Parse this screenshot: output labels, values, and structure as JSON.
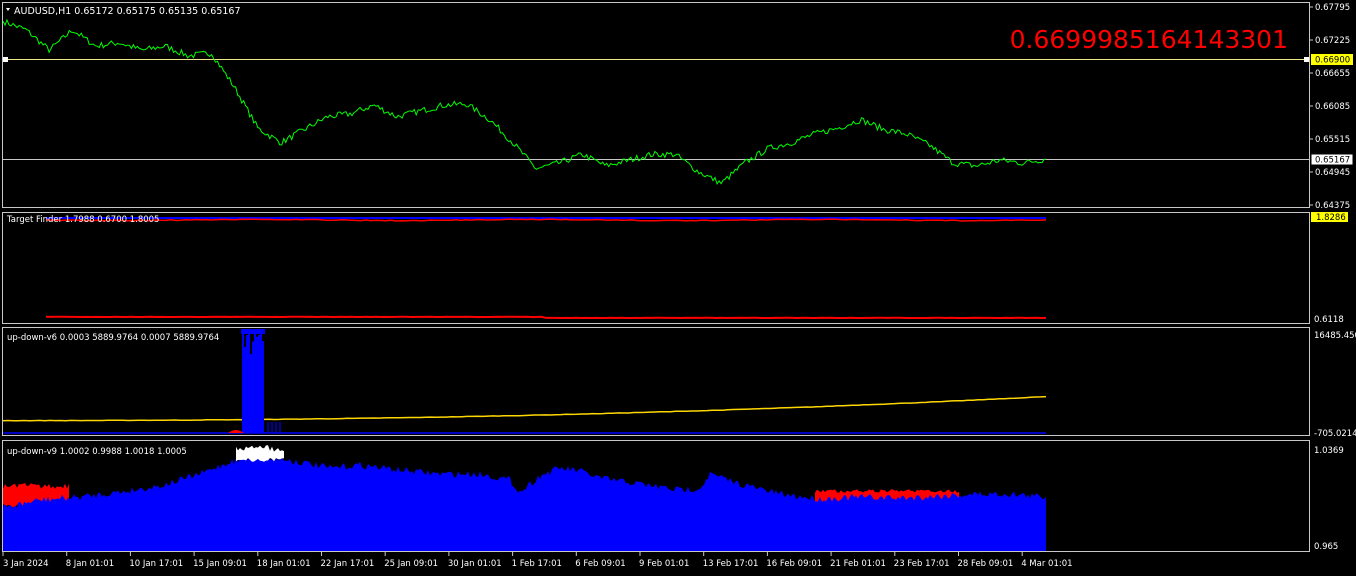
{
  "chart_data": [
    {
      "pane": "price",
      "type": "line",
      "header": "AUDUSD,H1  0.65172 0.65175 0.65135 0.65167",
      "symbol": "AUDUSD,H1",
      "ohlc": [
        0.65172,
        0.65175,
        0.65135,
        0.65167
      ],
      "big_label": "0.6699985164143301",
      "ylim": [
        0.64375,
        0.67795
      ],
      "y_ticks": [
        "0.67795",
        "0.67225",
        "0.66655",
        "0.66085",
        "0.65515",
        "0.64945",
        "0.64375"
      ],
      "horizontal_lines": [
        {
          "value": 0.669,
          "label": "0.66900",
          "color": "#f0e68c",
          "badge": "yellow"
        },
        {
          "value": 0.65167,
          "label": "0.65167",
          "color": "#c8c8c8",
          "badge": "white"
        }
      ],
      "series": [
        {
          "color": "#00ff00",
          "keypoints": [
            [
              0,
              0.6755
            ],
            [
              1,
              0.674
            ],
            [
              2,
              0.6705
            ],
            [
              3,
              0.674
            ],
            [
              4,
              0.6712
            ],
            [
              5,
              0.6718
            ],
            [
              6,
              0.6705
            ],
            [
              7,
              0.6712
            ],
            [
              8,
              0.6695
            ],
            [
              9,
              0.67
            ],
            [
              10,
              0.664
            ],
            [
              11,
              0.657
            ],
            [
              12,
              0.6545
            ],
            [
              13,
              0.6568
            ],
            [
              14,
              0.659
            ],
            [
              15,
              0.6595
            ],
            [
              16,
              0.661
            ],
            [
              17,
              0.659
            ],
            [
              18,
              0.66
            ],
            [
              19,
              0.661
            ],
            [
              20,
              0.6612
            ],
            [
              21,
              0.6585
            ],
            [
              22,
              0.6545
            ],
            [
              23,
              0.65
            ],
            [
              24,
              0.651
            ],
            [
              25,
              0.6525
            ],
            [
              26,
              0.6505
            ],
            [
              27,
              0.6515
            ],
            [
              28,
              0.6525
            ],
            [
              29,
              0.6525
            ],
            [
              30,
              0.6495
            ],
            [
              31,
              0.6475
            ],
            [
              32,
              0.651
            ],
            [
              33,
              0.6535
            ],
            [
              34,
              0.6545
            ],
            [
              35,
              0.656
            ],
            [
              36,
              0.657
            ],
            [
              37,
              0.6585
            ],
            [
              38,
              0.6568
            ],
            [
              39,
              0.656
            ],
            [
              40,
              0.654
            ],
            [
              41,
              0.651
            ],
            [
              42,
              0.6505
            ],
            [
              43,
              0.6515
            ],
            [
              44,
              0.651
            ],
            [
              45,
              0.65167
            ]
          ]
        }
      ]
    },
    {
      "pane": "target-finder",
      "type": "line",
      "header": "Target Finder 1.7988 0.6700 1.8005",
      "name": "Target Finder",
      "values": [
        1.7988,
        0.67,
        1.8005
      ],
      "ylim": [
        0.6118,
        1.8286
      ],
      "y_ticks": [
        "1.8286",
        "0.6118"
      ],
      "badge": "1.8286",
      "series": [
        {
          "color": "#0000ff",
          "level": 1.8005
        },
        {
          "color": "#ff0000",
          "level": 1.7988
        },
        {
          "color": "#ff0000",
          "level": 0.67
        }
      ]
    },
    {
      "pane": "up-down-v6",
      "type": "line",
      "header": "up-down-v6 0.0003 5889.9764 0.0007 5889.9764",
      "name": "up-down-v6",
      "values": [
        0.0003,
        5889.9764,
        0.0007,
        5889.9764
      ],
      "ylim": [
        0,
        16485.45
      ],
      "y_ticks": [
        "16485.450",
        "-705.0214"
      ],
      "series": [
        {
          "color": "#ffd700",
          "start": 1900,
          "end": 5890
        },
        {
          "color": "#0000ff",
          "level": 0
        },
        {
          "color": "#0000ff",
          "spike_peak": 16400
        }
      ]
    },
    {
      "pane": "up-down-v9",
      "type": "area",
      "header": "up-down-v9 1.0002 0.9988 1.0018 1.0005",
      "name": "up-down-v9",
      "values": [
        1.0002,
        0.9988,
        1.0018,
        1.0005
      ],
      "ylim": [
        0.965,
        1.0369
      ],
      "y_ticks": [
        "1.0369",
        "0.965"
      ],
      "series": [
        {
          "color": "#0000ff",
          "type": "area"
        },
        {
          "color": "#ff0000",
          "type": "area"
        },
        {
          "color": "#ffffff",
          "type": "area"
        }
      ]
    }
  ],
  "x_axis": {
    "labels": [
      "3 Jan 2024",
      "8 Jan 01:01",
      "10 Jan 17:01",
      "15 Jan 09:01",
      "18 Jan 01:01",
      "22 Jan 17:01",
      "25 Jan 09:01",
      "30 Jan 01:01",
      "1 Feb 17:01",
      "6 Feb 09:01",
      "9 Feb 01:01",
      "13 Feb 17:01",
      "16 Feb 09:01",
      "21 Feb 01:01",
      "23 Feb 17:01",
      "28 Feb 09:01",
      "4 Mar 01:01"
    ]
  },
  "colors": {
    "background": "#000000",
    "price": "#00ff00",
    "big_label": "#ff0000",
    "axis": "#c8c8c8"
  }
}
